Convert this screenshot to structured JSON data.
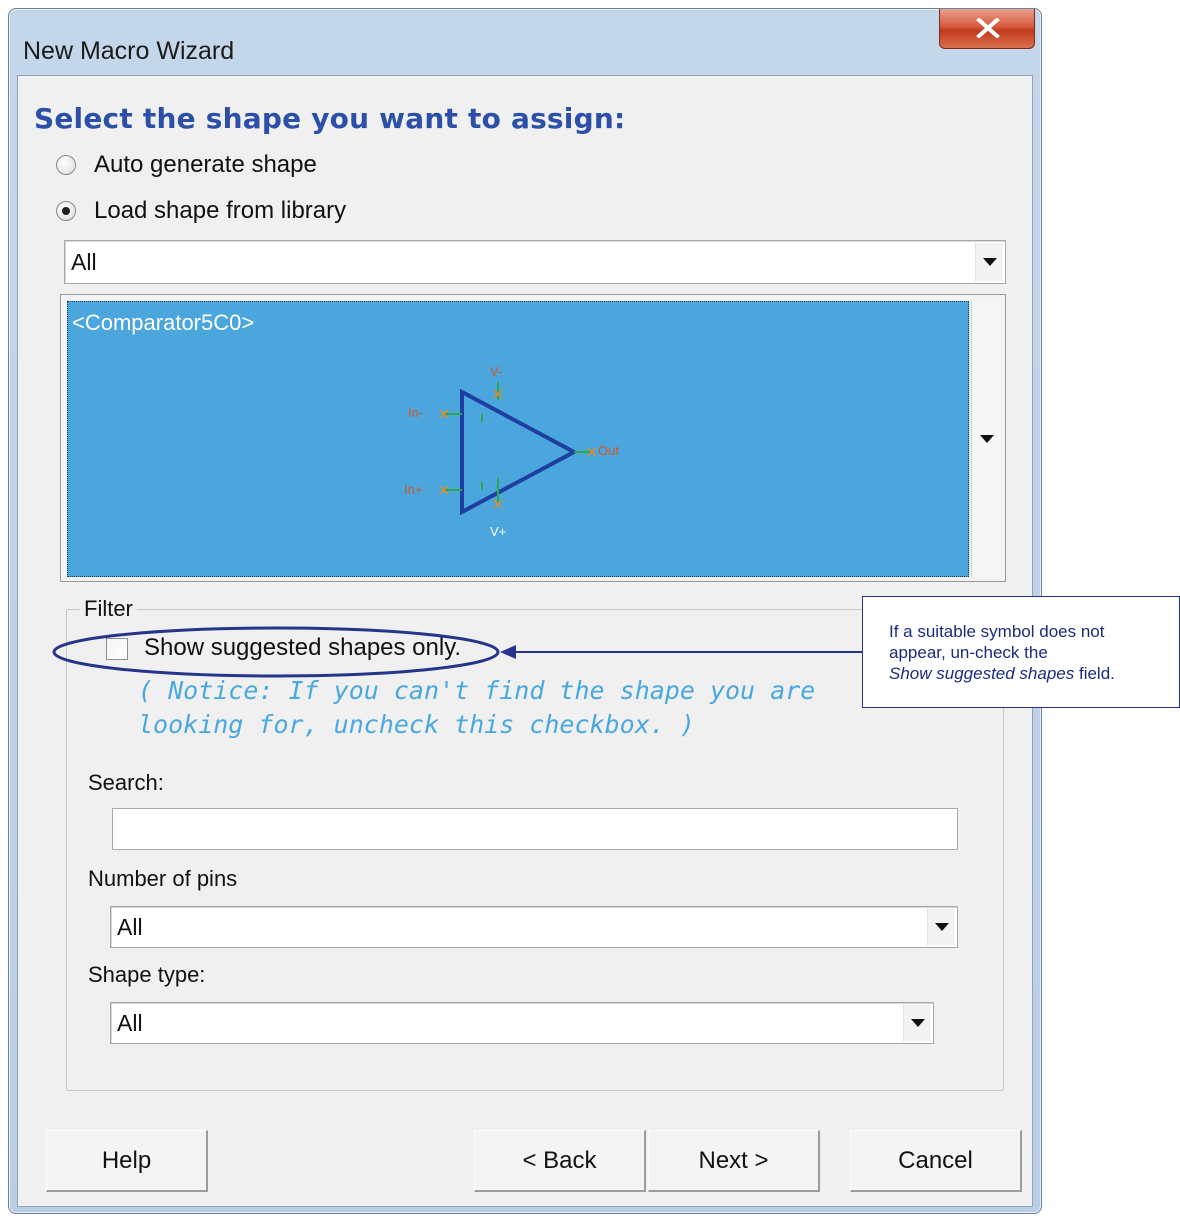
{
  "window": {
    "title": "New Macro Wizard",
    "close_icon": "close-x-icon"
  },
  "heading": "Select the shape you want to assign:",
  "shape_source": {
    "auto_label": "Auto generate shape",
    "auto_checked": false,
    "library_label": "Load shape from library",
    "library_checked": true
  },
  "library_combo": {
    "value": "All"
  },
  "preview": {
    "name": "<Comparator5C0>",
    "pins": {
      "v_minus": "V-",
      "v_plus": "V+",
      "in_minus": "In-",
      "in_plus": "In+",
      "out": "Out"
    }
  },
  "filter": {
    "legend": "Filter",
    "checkbox_label": "Show suggested shapes only.",
    "checkbox_checked": false,
    "notice": "( Notice: If you can't find the shape you are looking for, uncheck this checkbox. )",
    "search_label": "Search:",
    "search_value": "",
    "pins_label": "Number of pins",
    "pins_value": "All",
    "type_label": "Shape type:",
    "type_value": "All"
  },
  "buttons": {
    "help": "Help",
    "back": "< Back",
    "next": "Next >",
    "cancel": "Cancel"
  },
  "callout": {
    "line1": "If a suitable symbol does not",
    "line2": "appear, un-check the",
    "line3_em": "Show suggested shapes",
    "line3_rest": " field."
  },
  "colors": {
    "heading": "#2c50a8",
    "preview_bg": "#4aa6dd",
    "notice": "#4aa8e0",
    "annotation": "#26348a"
  }
}
